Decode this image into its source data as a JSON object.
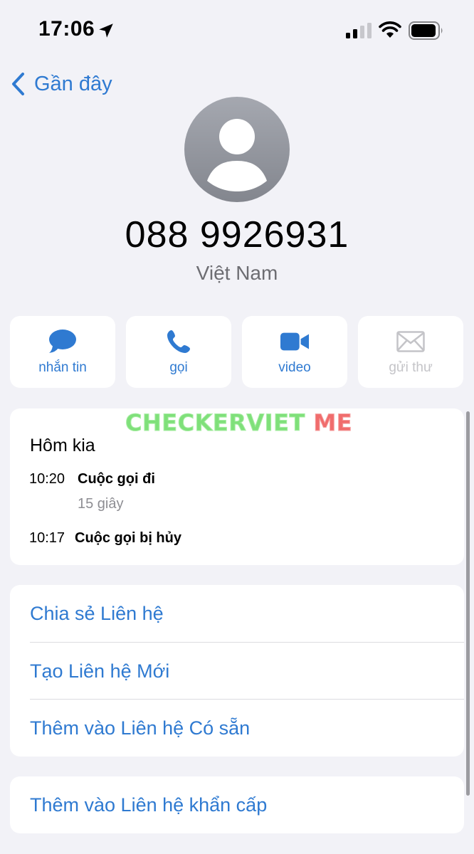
{
  "status_bar": {
    "time": "17:06"
  },
  "nav": {
    "back_label": "Gần đây"
  },
  "contact": {
    "phone": "088 9926931",
    "country": "Việt Nam"
  },
  "actions": [
    {
      "label": "nhắn tin",
      "icon": "message-icon",
      "enabled": true
    },
    {
      "label": "gọi",
      "icon": "phone-icon",
      "enabled": true
    },
    {
      "label": "video",
      "icon": "video-camera-icon",
      "enabled": true
    },
    {
      "label": "gửi thư",
      "icon": "mail-icon",
      "enabled": false
    }
  ],
  "watermark": {
    "part1": "CHECKERVIET",
    "part2": "ME"
  },
  "recents": {
    "day": "Hôm kia",
    "calls": [
      {
        "time": "10:20",
        "type": "Cuộc gọi đi",
        "duration": "15 giây"
      },
      {
        "time": "10:17",
        "type": "Cuộc gọi bị hủy",
        "duration": ""
      }
    ]
  },
  "options": [
    "Chia sẻ Liên hệ",
    "Tạo Liên hệ Mới",
    "Thêm vào Liên hệ Có sẵn"
  ],
  "emergency": "Thêm vào Liên hệ khẩn cấp",
  "colors": {
    "accent": "#2f7ad1",
    "background": "#f2f2f7",
    "disabled": "#c4c4c8"
  }
}
